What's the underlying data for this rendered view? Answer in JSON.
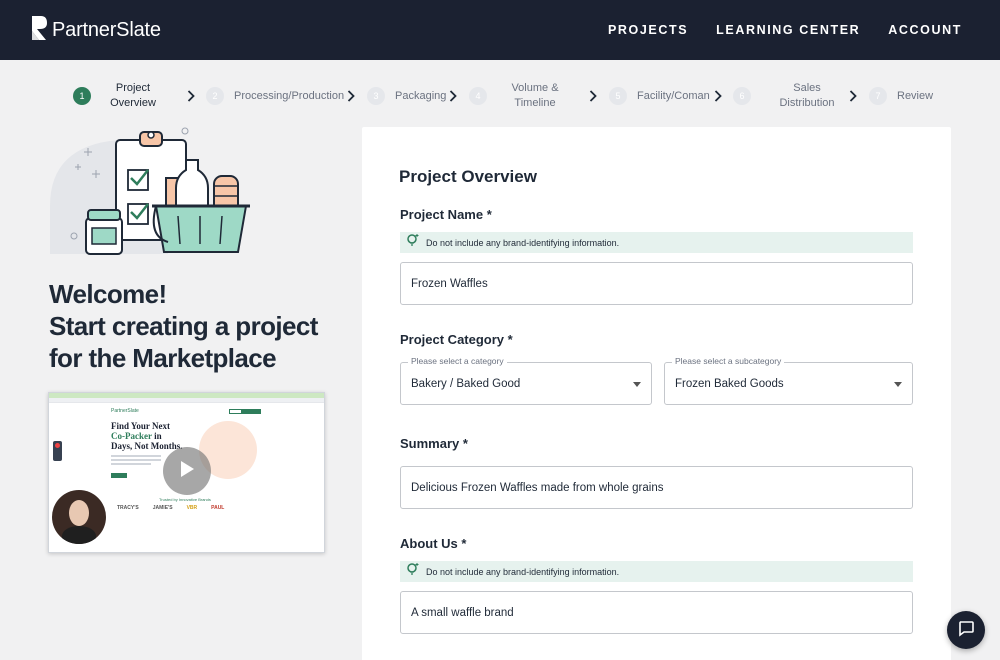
{
  "app": {
    "logo_text": "PartnerSlate",
    "nav": [
      "PROJECTS",
      "LEARNING CENTER",
      "ACCOUNT"
    ]
  },
  "stepper": {
    "steps": [
      {
        "num": "1",
        "label": "Project\nOverview",
        "active": true
      },
      {
        "num": "2",
        "label": "Processing/Production",
        "active": false
      },
      {
        "num": "3",
        "label": "Packaging",
        "active": false
      },
      {
        "num": "4",
        "label": "Volume &\nTimeline",
        "active": false
      },
      {
        "num": "5",
        "label": "Facility/Coman",
        "active": false
      },
      {
        "num": "6",
        "label": "Sales\nDistribution",
        "active": false
      },
      {
        "num": "7",
        "label": "Review",
        "active": false
      }
    ]
  },
  "welcome": {
    "line1": "Welcome!",
    "line2": "Start creating a project",
    "line3": "for the Marketplace"
  },
  "video": {
    "brand": "PartnerSlate",
    "headline_1": "Find Your Next",
    "headline_2": "Co-Packer",
    "headline_3": "in",
    "headline_4": "Days, Not Months.",
    "trusted": "Trusted by Innovative Brands",
    "logos": [
      "TRACY'S",
      "JAMIE'S",
      "VBR",
      "PAUL"
    ]
  },
  "form": {
    "title": "Project Overview",
    "project_name": {
      "label": "Project Name *",
      "hint": "Do not include any brand-identifying information.",
      "value": "Frozen Waffles"
    },
    "project_category": {
      "label": "Project Category *",
      "category_legend": "Please select a category",
      "category_value": "Bakery / Baked Good",
      "subcategory_legend": "Please select a subcategory",
      "subcategory_value": "Frozen Baked Goods"
    },
    "summary": {
      "label": "Summary *",
      "value": "Delicious Frozen Waffles made from whole grains"
    },
    "about_us": {
      "label": "About Us *",
      "hint": "Do not include any brand-identifying information.",
      "value": "A small waffle brand"
    }
  },
  "colors": {
    "nav_bg": "#1b2131",
    "accent_green": "#2e7d5b",
    "hint_bg": "#e6f2ee",
    "page_bg": "#f1f1f2"
  }
}
